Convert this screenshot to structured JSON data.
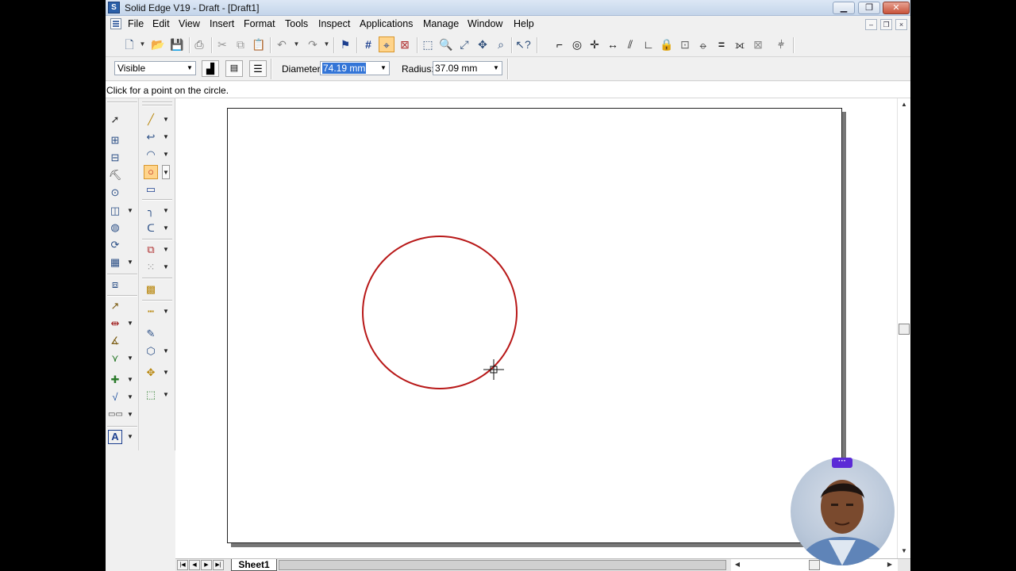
{
  "window": {
    "title": "Solid Edge V19 - Draft - [Draft1]",
    "icon": "solid-edge-app-icon",
    "controls": {
      "minimize": "▁",
      "restore": "❐",
      "close": "✕"
    }
  },
  "menubar": {
    "items": [
      "File",
      "Edit",
      "View",
      "Insert",
      "Format",
      "Tools",
      "Inspect",
      "Applications",
      "Manage",
      "Window",
      "Help"
    ],
    "mdi_controls": {
      "minimize": "–",
      "restore": "❐",
      "close": "×"
    }
  },
  "ribbon": {
    "line_style": "Visible",
    "diameter_label": "Diameter:",
    "diameter_value": "74.19 mm",
    "radius_label": "Radius:",
    "radius_value": "37.09 mm"
  },
  "prompt": {
    "text": "Click for a point on the circle."
  },
  "sheet_tabs": {
    "active": "Sheet1"
  },
  "colors": {
    "circle_stroke": "#b81818",
    "active_tool": "#ffd48a",
    "selection": "#3375d7",
    "webcam_badge": "#5b2bd6"
  },
  "webcam_badge": "···"
}
